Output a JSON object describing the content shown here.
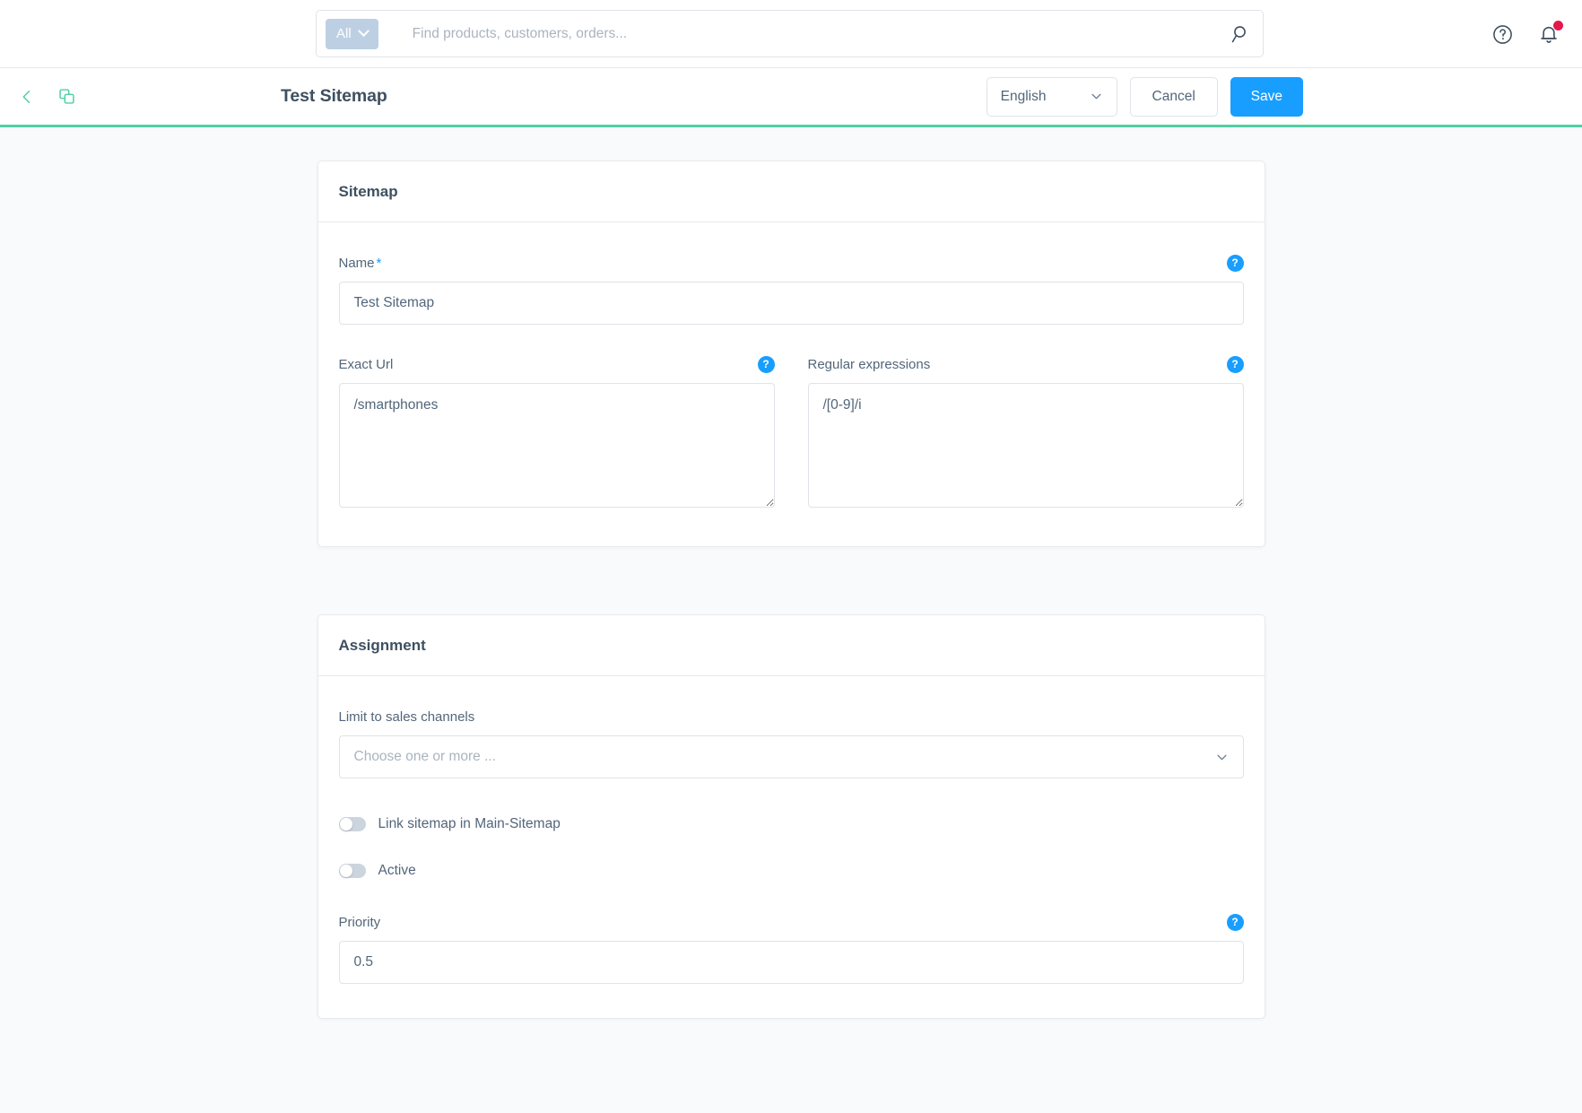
{
  "topbar": {
    "search": {
      "scope_label": "All",
      "scope_icon": "chevron-down-icon",
      "placeholder": "Find products, customers, orders...",
      "value": "",
      "search_icon": "search-icon"
    },
    "help_icon": "question-mark-circle-icon",
    "notifications_icon": "bell-icon",
    "notification_badge": ""
  },
  "pageheader": {
    "back_icon": "chevron-left-icon",
    "duplicate_icon": "copy-icon",
    "title": "Test Sitemap",
    "language": {
      "value": "English",
      "caret_icon": "chevron-down-icon"
    },
    "cancel_label": "Cancel",
    "save_label": "Save",
    "accent_color": "#4fd0a0"
  },
  "cards": {
    "sitemap": {
      "title": "Sitemap",
      "name": {
        "label": "Name",
        "required_marker": "*",
        "value": "Test Sitemap",
        "help_icon": "question-mark-circle-icon"
      },
      "exact_url": {
        "label": "Exact Url",
        "value": "/smartphones",
        "help_icon": "question-mark-circle-icon"
      },
      "regular_expressions": {
        "label": "Regular expressions",
        "value": "/[0-9]/i",
        "help_icon": "question-mark-circle-icon"
      }
    },
    "assignment": {
      "title": "Assignment",
      "sales_channels": {
        "label": "Limit to sales channels",
        "placeholder": "Choose one or more ...",
        "value": "",
        "caret_icon": "chevron-down-icon"
      },
      "link_sitemap": {
        "label": "Link sitemap in Main-Sitemap",
        "state": "off"
      },
      "active": {
        "label": "Active",
        "state": "off"
      },
      "priority": {
        "label": "Priority",
        "value": "0.5",
        "help_icon": "question-mark-circle-icon"
      }
    }
  },
  "colors": {
    "accent_blue": "#189eff",
    "accent_green": "#4fd0a0",
    "badge_red": "#e5184a",
    "text": "#52667a",
    "page_bg": "#f9fafb"
  }
}
